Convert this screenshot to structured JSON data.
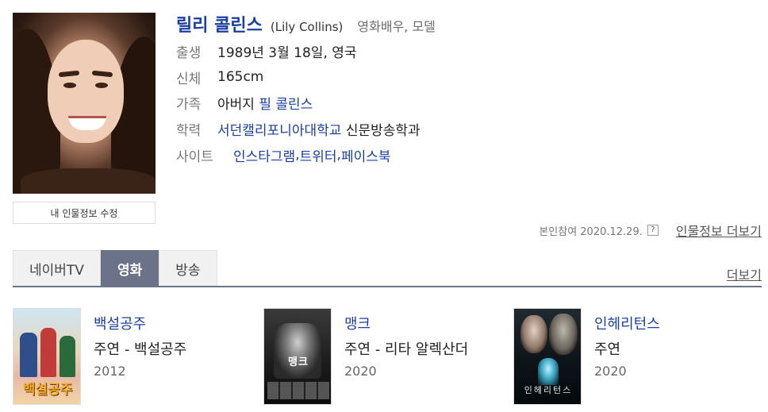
{
  "profile": {
    "name_ko": "릴리 콜린스",
    "name_en": "(Lily Collins)",
    "occupation": "영화배우, 모델",
    "photo_icon": "person-photo",
    "edit_button": "내 인물정보 수정"
  },
  "info": {
    "birth_label": "출생",
    "birth_value": "1989년 3월 18일, 영국",
    "body_label": "신체",
    "body_value": "165cm",
    "family_label": "가족",
    "family_prefix": "아버지",
    "family_link": "필 콜린스",
    "education_label": "학력",
    "education_link": "서던캘리포니아대학교",
    "education_suffix": "신문방송학과",
    "site_label": "사이트",
    "site_links": [
      "인스타그램",
      "트위터",
      "페이스북"
    ],
    "site_sep": ", "
  },
  "meta": {
    "participation": "본인참여 2020.12.29.",
    "help_icon": "?",
    "more_profile": "인물정보 더보기"
  },
  "tabs": [
    {
      "label": "네이버TV",
      "active": false
    },
    {
      "label": "영화",
      "active": true
    },
    {
      "label": "방송",
      "active": false
    }
  ],
  "more_link": "더보기",
  "movies": [
    {
      "title": "백설공주",
      "role": "주연 - 백설공주",
      "year": "2012",
      "poster_text": "백설공주"
    },
    {
      "title": "맹크",
      "role": "주연 - 리타 알렉산더",
      "year": "2020",
      "poster_text": "맹크"
    },
    {
      "title": "인헤리턴스",
      "role": "주연",
      "year": "2020",
      "poster_text": "인헤리턴스"
    }
  ],
  "colors": {
    "link": "#1a3fa0",
    "tab_active": "#6c7287"
  }
}
